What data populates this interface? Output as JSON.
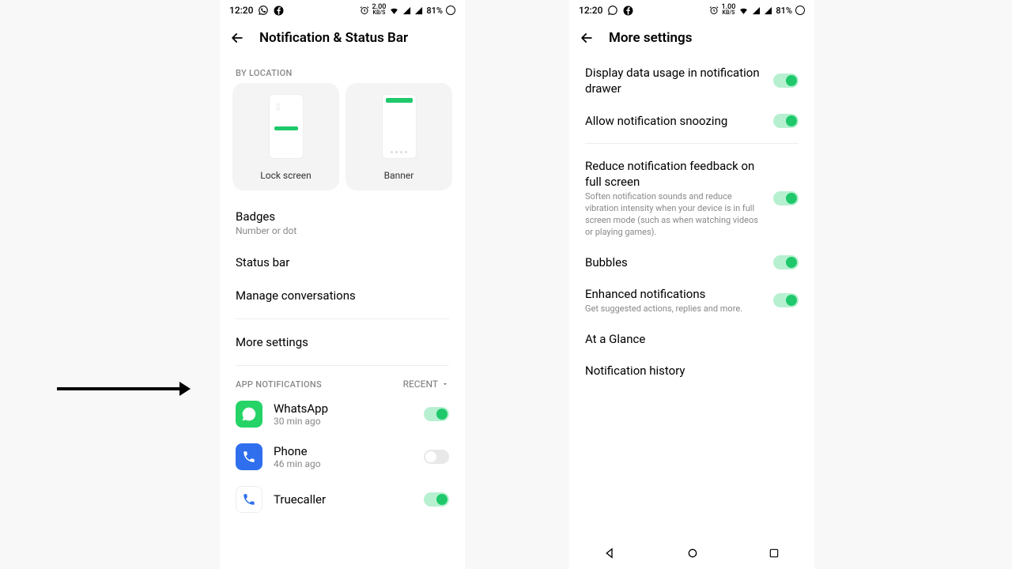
{
  "status": {
    "time": "12:20",
    "kbs1": "2.00",
    "kbs2": "1.00",
    "kbsUnit": "KB/S",
    "battery": "81%"
  },
  "screen1": {
    "title": "Notification & Status Bar",
    "byLocation": "BY LOCATION",
    "lockScreen": "Lock screen",
    "banner": "Banner",
    "badges": "Badges",
    "badgesSub": "Number or dot",
    "statusBar": "Status bar",
    "manageConv": "Manage conversations",
    "moreSettings": "More settings",
    "appNotifications": "APP NOTIFICATIONS",
    "recent": "RECENT",
    "apps": [
      {
        "name": "WhatsApp",
        "time": "30 min ago"
      },
      {
        "name": "Phone",
        "time": "46 min ago"
      },
      {
        "name": "Truecaller",
        "time": ""
      }
    ]
  },
  "screen2": {
    "title": "More settings",
    "items": {
      "dataUsage": "Display data usage in notification drawer",
      "snoozing": "Allow notification snoozing",
      "reduceFb": "Reduce notification feedback on full screen",
      "reduceFbDesc": "Soften notification sounds and reduce vibration intensity when your device is in full screen mode (such as when watching videos or playing games).",
      "bubbles": "Bubbles",
      "enhanced": "Enhanced notifications",
      "enhancedDesc": "Get suggested actions, replies and more.",
      "glance": "At a Glance",
      "history": "Notification history"
    }
  }
}
